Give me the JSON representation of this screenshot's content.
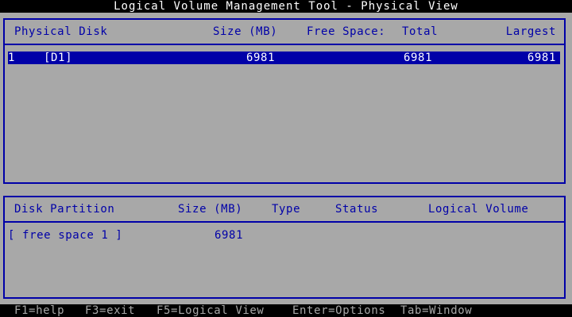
{
  "window": {
    "title": "Logical Volume Management Tool - Physical View"
  },
  "physical_disks": {
    "columns": {
      "disk": "Physical Disk",
      "size": "Size (MB)",
      "free_space": "Free Space:",
      "total": "Total",
      "largest": "Largest"
    },
    "rows": [
      {
        "index": "1",
        "name": "[D1]",
        "size": "6981",
        "total": "6981",
        "largest": "6981",
        "selected": true
      }
    ]
  },
  "partitions": {
    "columns": {
      "partition": "Disk Partition",
      "size": "Size (MB)",
      "type": "Type",
      "status": "Status",
      "logical_volume": "Logical Volume"
    },
    "rows": [
      {
        "name": "[ free space 1 ]",
        "size": "6981",
        "type": "",
        "status": "",
        "logical_volume": ""
      }
    ]
  },
  "statusbar": {
    "help": "F1=help",
    "exit": "F3=exit",
    "logical_view": "F5=Logical View",
    "options": "Enter=Options",
    "window": "Tab=Window"
  },
  "colors": {
    "background": "#a8a8a8",
    "foreground": "#0000a8",
    "selection": "#0000a8",
    "bar": "#000000"
  }
}
